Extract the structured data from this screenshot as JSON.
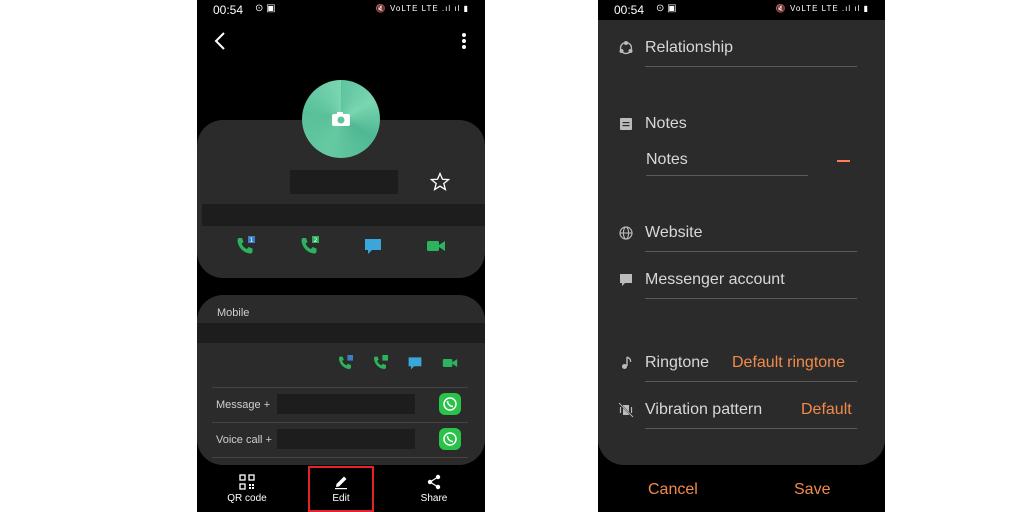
{
  "status_bar": {
    "time": "00:54",
    "left_icons": "⊙ ▣",
    "right_icons": "🔇 VoLTE LTE .ıl ıl ▮"
  },
  "contact": {
    "back_icon": "chevron-left-icon",
    "more_icon": "more-vertical-icon",
    "avatar_icon": "camera-icon",
    "favorite_icon": "star-outline-icon",
    "actions": [
      {
        "icon": "phone-sim1-icon",
        "badge": "1",
        "color": "#2db35d"
      },
      {
        "icon": "phone-sim2-icon",
        "badge": "2",
        "color": "#2db35d"
      },
      {
        "icon": "message-icon",
        "badge": "",
        "color": "#3aa6d9"
      },
      {
        "icon": "video-icon",
        "badge": "",
        "color": "#2db35d"
      }
    ]
  },
  "details": {
    "mobile_label": "Mobile",
    "rows": [
      {
        "label": "Message +",
        "icon": "whatsapp-icon"
      },
      {
        "label": "Voice call +",
        "icon": "whatsapp-icon"
      }
    ]
  },
  "bottom_bar": {
    "qr_label": "QR code",
    "edit_label": "Edit",
    "share_label": "Share"
  },
  "edit_form": {
    "relationship_label": "Relationship",
    "notes_header": "Notes",
    "notes_placeholder": "Notes",
    "website_label": "Website",
    "messenger_label": "Messenger account",
    "ringtone_label": "Ringtone",
    "ringtone_value": "Default ringtone",
    "vibration_label": "Vibration pattern",
    "vibration_value": "Default",
    "cancel_label": "Cancel",
    "save_label": "Save"
  },
  "colors": {
    "accent": "#f28a4a",
    "highlight": "#e3222b",
    "whatsapp": "#29c34a",
    "card": "#2b2b2b"
  }
}
